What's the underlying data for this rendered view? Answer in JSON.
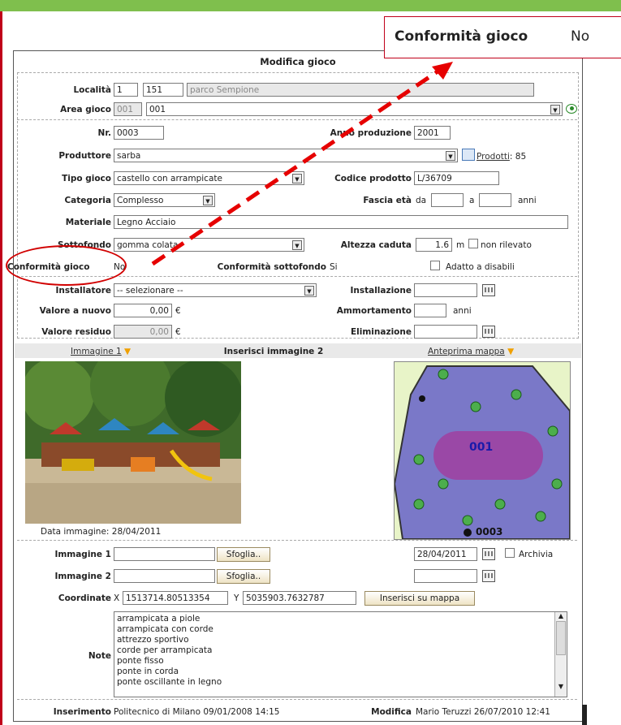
{
  "callout": {
    "label": "Conformità gioco",
    "value": "No"
  },
  "form": {
    "title": "Modifica gioco",
    "localita": {
      "label": "Località",
      "num1": "1",
      "num2": "151",
      "name": "parco Sempione"
    },
    "area_gioco": {
      "label": "Area gioco",
      "code": "001",
      "value": "001"
    },
    "nr": {
      "label": "Nr.",
      "value": "0003"
    },
    "anno_produzione": {
      "label": "Anno produzione",
      "value": "2001"
    },
    "produttore": {
      "label": "Produttore",
      "value": "sarba",
      "prodotti_link": "Prodotti",
      "prodotti_count": ": 85"
    },
    "tipo_gioco": {
      "label": "Tipo gioco",
      "value": "castello con arrampicate"
    },
    "codice_prodotto": {
      "label": "Codice prodotto",
      "value": "L/36709"
    },
    "categoria": {
      "label": "Categoria",
      "value": "Complesso"
    },
    "fascia_eta": {
      "label": "Fascia età",
      "da": "da",
      "a": "a",
      "anni": "anni"
    },
    "materiale": {
      "label": "Materiale",
      "value": "Legno Acciaio"
    },
    "sottofondo": {
      "label": "Sottofondo",
      "value": "gomma colata"
    },
    "altezza_caduta": {
      "label": "Altezza caduta",
      "value": "1.6",
      "unit": "m",
      "non_rilevato": "non rilevato"
    },
    "conformita_gioco": {
      "label": "Conformità gioco",
      "value": "No"
    },
    "conformita_sottofondo": {
      "label": "Conformità sottofondo",
      "value": "Si"
    },
    "adatto_disabili": {
      "label": "Adatto a disabili"
    },
    "installatore": {
      "label": "Installatore",
      "value": "-- selezionare --"
    },
    "installazione": {
      "label": "Installazione",
      "value": ""
    },
    "valore_nuovo": {
      "label": "Valore a nuovo",
      "value": "0,00",
      "unit": "€"
    },
    "ammortamento": {
      "label": "Ammortamento",
      "value": "",
      "unit": "anni"
    },
    "valore_residuo": {
      "label": "Valore residuo",
      "value": "0,00",
      "unit": "€"
    },
    "eliminazione": {
      "label": "Eliminazione",
      "value": ""
    },
    "images_bar": {
      "immagine1": "Immagine 1",
      "inserisci2": "Inserisci immagine 2",
      "anteprima": "Anteprima mappa"
    },
    "data_immagine": "Data immagine: 28/04/2011",
    "map_label": "001",
    "map_label2": "0003",
    "upload1": {
      "label": "Immagine 1",
      "button": "Sfoglia..",
      "date": "28/04/2011",
      "archivia": "Archivia"
    },
    "upload2": {
      "label": "Immagine 2",
      "button": "Sfoglia..",
      "date": ""
    },
    "coordinate": {
      "label": "Coordinate",
      "x_label": "X",
      "x": "1513714.80513354",
      "y_label": "Y",
      "y": "5035903.7632787",
      "button": "Inserisci su mappa"
    },
    "note": {
      "label": "Note",
      "lines": [
        "arrampicata a piole",
        "arrampicata con corde",
        "attrezzo sportivo",
        "corde per arrampicata",
        "ponte fisso",
        "ponte in corda",
        "ponte oscillante in legno"
      ]
    },
    "footer": {
      "ins_label": "Inserimento",
      "ins_value": "Politecnico di Milano 09/01/2008 14:15",
      "mod_label": "Modifica",
      "mod_value": "Mario Teruzzi 26/07/2010 12:41"
    }
  },
  "colors": {
    "accent_red": "#d10000",
    "arrow_red": "#e60000",
    "top_green": "#7fbf4d"
  }
}
